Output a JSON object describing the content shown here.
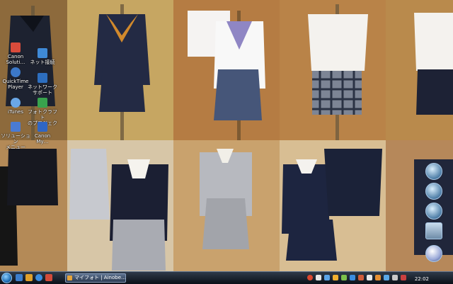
{
  "desktop": {
    "icons": [
      {
        "name": "canon-solution-icon",
        "label": "Canon\nSoluti…"
      },
      {
        "name": "quicktime-player-icon",
        "label": "QuickTime\nPlayer"
      },
      {
        "name": "itunes-icon",
        "label": "iTunes"
      },
      {
        "name": "solution-menu-icon",
        "label": "ソリューション\nメニュー"
      },
      {
        "name": "network-icon",
        "label": "ネット接続"
      },
      {
        "name": "network-support-icon",
        "label": "ネットワーク\nサポート"
      },
      {
        "name": "photo-icon",
        "label": "フォトクラフト\nのプロジェクト"
      },
      {
        "name": "canon-my-icon",
        "label": "Canon\nMy…"
      }
    ]
  },
  "taskbar": {
    "task_label": "マイフォト | Ainobe…",
    "clock": "22:02"
  },
  "colors": {
    "wall_warm": "#b98a4c",
    "wall_light": "#d8c08a",
    "taskbar": "#1b2430",
    "accent": "#4e7ea7"
  }
}
